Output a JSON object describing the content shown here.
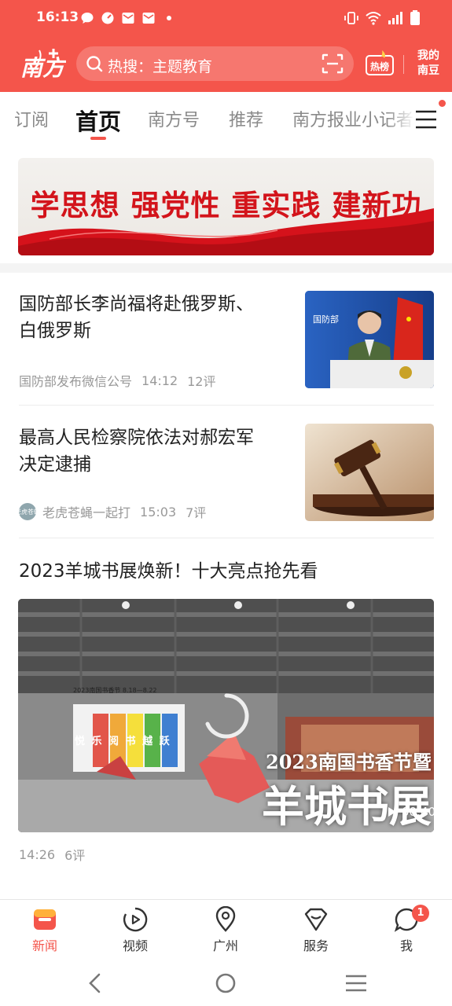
{
  "status_bar": {
    "time": "16:13",
    "left_icons": [
      "chat-bubble-icon",
      "speedometer-icon",
      "mail-icon",
      "mail-icon",
      "dot-icon"
    ],
    "right_icons": [
      "vibrate-icon",
      "wifi-icon",
      "signal-icon",
      "battery-icon"
    ]
  },
  "header": {
    "logo_text": "南方+",
    "search_placeholder": "热搜：主题教育",
    "hot_list_label": "热榜",
    "my_nandou_line1": "我的",
    "my_nandou_line2": "南豆",
    "brand_color": "#f4554b"
  },
  "tabs": [
    {
      "label": "订阅",
      "active": false
    },
    {
      "label": "首页",
      "active": true
    },
    {
      "label": "南方号",
      "active": false
    },
    {
      "label": "推荐",
      "active": false
    },
    {
      "label": "南方报业小记者",
      "active": false
    }
  ],
  "banner": {
    "text": "学思想  强党性  重实践  建新功"
  },
  "articles": [
    {
      "title_line1": "国防部长李尚福将赴俄罗斯、",
      "title_line2": "白俄罗斯",
      "source": "国防部发布微信公号",
      "time": "14:12",
      "comments": "12评",
      "thumb_text": "国防部"
    },
    {
      "title_line1": "最高人民检察院依法对郝宏军",
      "title_line2": "决定逮捕",
      "source": "老虎苍蝇一起打",
      "source_avatar_text": "老虎苍蝇",
      "time": "15:03",
      "comments": "7评"
    },
    {
      "title": "2023羊城书展焕新！十大亮点抢先看",
      "time": "14:26",
      "comments": "6评",
      "video": {
        "caption_line1": "2023南国书香节暨",
        "caption_line2": "羊城书展",
        "duration": "00:40",
        "poster_dates": "2023南国书香节 8.18—8.22",
        "poster_slogan": "悦 乐 阅 书 越 跃"
      }
    }
  ],
  "bottom_nav": [
    {
      "label": "新闻",
      "icon": "news-icon",
      "active": true
    },
    {
      "label": "视频",
      "icon": "video-icon",
      "active": false
    },
    {
      "label": "广州",
      "icon": "location-icon",
      "active": false
    },
    {
      "label": "服务",
      "icon": "service-icon",
      "active": false
    },
    {
      "label": "我",
      "icon": "profile-icon",
      "active": false,
      "badge": "1"
    }
  ],
  "system_nav": [
    "back-icon",
    "home-icon",
    "recents-icon"
  ]
}
